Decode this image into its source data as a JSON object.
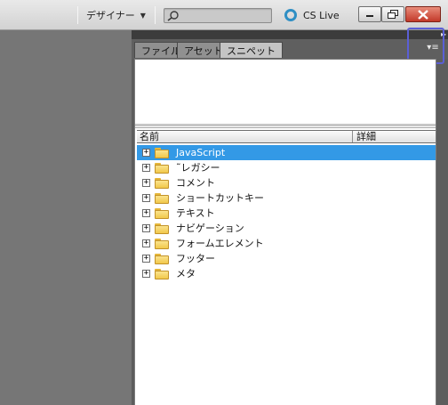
{
  "topbar": {
    "workspace_label": "デザイナー",
    "workspace_arrow": "▼",
    "search_placeholder": "",
    "cs_live_label": "CS Live"
  },
  "window_controls": {
    "minimize": "–",
    "restore": "❐",
    "close": "✕"
  },
  "panel": {
    "collapse_glyph": "▸▸",
    "menu_glyph": "▾≡",
    "tabs": [
      {
        "label": "ファイル",
        "active": false
      },
      {
        "label": "アセット",
        "active": false
      },
      {
        "label": "スニペット",
        "active": true
      }
    ]
  },
  "tree": {
    "columns": {
      "name": "名前",
      "detail": "詳細"
    },
    "items": [
      {
        "label": "JavaScript",
        "selected": true
      },
      {
        "label": "˜レガシー",
        "selected": false
      },
      {
        "label": "コメント",
        "selected": false
      },
      {
        "label": "ショートカットキー",
        "selected": false
      },
      {
        "label": "テキスト",
        "selected": false
      },
      {
        "label": "ナビゲーション",
        "selected": false
      },
      {
        "label": "フォームエレメント",
        "selected": false
      },
      {
        "label": "フッター",
        "selected": false
      },
      {
        "label": "メタ",
        "selected": false
      }
    ],
    "expander_glyph": "+"
  },
  "colors": {
    "selection": "#3399e6",
    "cs_live_ring": "#2f8fc4",
    "close_button": "#c2392a",
    "focus_outline": "#5b5fd6"
  },
  "icons": [
    "search-icon",
    "cs-live-icon",
    "minimize-icon",
    "restore-icon",
    "close-icon",
    "collapse-panel-icon",
    "panel-menu-icon",
    "folder-icon",
    "expand-icon"
  ]
}
